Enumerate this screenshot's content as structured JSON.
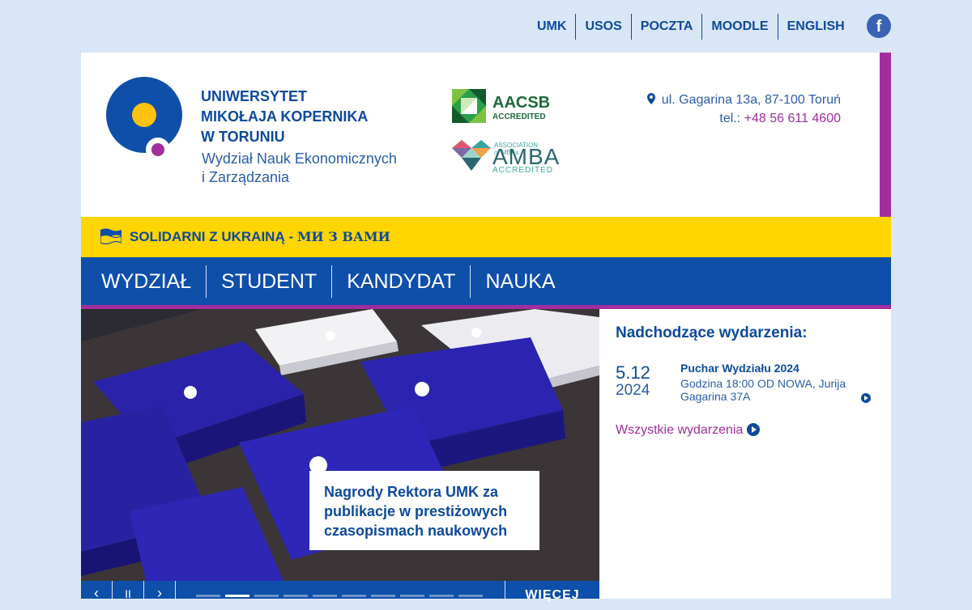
{
  "top_links": [
    "UMK",
    "USOS",
    "POCZTA",
    "MOODLE",
    "ENGLISH"
  ],
  "facebook_icon": "f",
  "university": {
    "line1": "UNIWERSYTET",
    "line2": "MIKOŁAJA KOPERNIKA",
    "line3": "W TORUNIU",
    "faculty_line1": "Wydział Nauk Ekonomicznych",
    "faculty_line2": "i Zarządzania"
  },
  "accreditations": {
    "aacsb": "AACSB",
    "aacsb_sub": "ACCREDITED",
    "amba_assoc": "ASSOCIATION of MBAs",
    "amba": "AMBA",
    "amba_sub": "ACCREDITED"
  },
  "contact": {
    "address": "ul. Gagarina 13a, 87-100 Toruń",
    "tel_label": "tel.: ",
    "phone": "+48 56 611 4600"
  },
  "ukraine_banner": {
    "text": "SOLIDARNI Z UKRAINĄ - ",
    "cyrillic": "МИ З ВАМИ"
  },
  "nav": [
    "WYDZIAŁ",
    "STUDENT",
    "KANDYDAT",
    "NAUKA"
  ],
  "slider": {
    "caption": "Nagrody Rektora UMK za publikacje w prestiżowych czasopismach naukowych",
    "prev_icon": "‹",
    "pause_icon": "II",
    "next_icon": "›",
    "more": "WIĘCEJ",
    "slide_count": 10,
    "active_slide": 2
  },
  "events": {
    "title": "Nadchodzące wydarzenia:",
    "items": [
      {
        "day": "5.12",
        "year": "2024",
        "name": "Puchar Wydziału 2024",
        "desc": "Godzina 18:00 OD NOWA, Jurija Gagarina 37A"
      }
    ],
    "all_label": "Wszystkie wydarzenia"
  },
  "colors": {
    "brand_blue": "#0e4faa",
    "accent_purple": "#a22d9e",
    "ukraine_yellow": "#ffd500",
    "page_bg": "#d9e6f7"
  }
}
